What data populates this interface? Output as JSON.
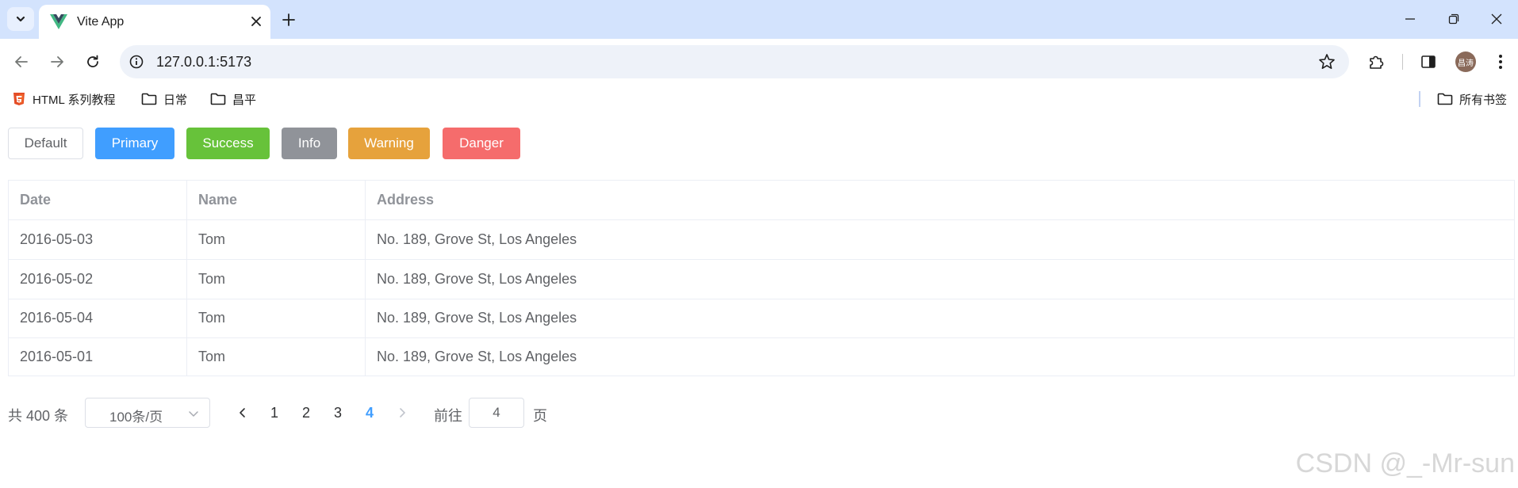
{
  "browser": {
    "tab_title": "Vite App",
    "url": "127.0.0.1:5173",
    "avatar_text": "昌涛",
    "bookmarks": [
      {
        "label": "HTML 系列教程",
        "icon": "html5-icon"
      },
      {
        "label": "日常",
        "icon": "folder-icon"
      },
      {
        "label": "昌平",
        "icon": "folder-icon"
      }
    ],
    "all_bookmarks_label": "所有书签"
  },
  "buttons": [
    {
      "label": "Default",
      "type": "default"
    },
    {
      "label": "Primary",
      "type": "primary",
      "color": "#409eff"
    },
    {
      "label": "Success",
      "type": "success",
      "color": "#67c23a"
    },
    {
      "label": "Info",
      "type": "info",
      "color": "#909399"
    },
    {
      "label": "Warning",
      "type": "warning",
      "color": "#e6a23c"
    },
    {
      "label": "Danger",
      "type": "danger",
      "color": "#f56c6c"
    }
  ],
  "table": {
    "columns": [
      "Date",
      "Name",
      "Address"
    ],
    "rows": [
      [
        "2016-05-03",
        "Tom",
        "No. 189, Grove St, Los Angeles"
      ],
      [
        "2016-05-02",
        "Tom",
        "No. 189, Grove St, Los Angeles"
      ],
      [
        "2016-05-04",
        "Tom",
        "No. 189, Grove St, Los Angeles"
      ],
      [
        "2016-05-01",
        "Tom",
        "No. 189, Grove St, Los Angeles"
      ]
    ]
  },
  "pagination": {
    "total_label": "共 400 条",
    "page_size": "100条/页",
    "pages": [
      "1",
      "2",
      "3",
      "4"
    ],
    "current_page": "4",
    "goto_label": "前往",
    "goto_value": "4",
    "goto_suffix": "页"
  },
  "watermark": "CSDN @_-Mr-sun"
}
